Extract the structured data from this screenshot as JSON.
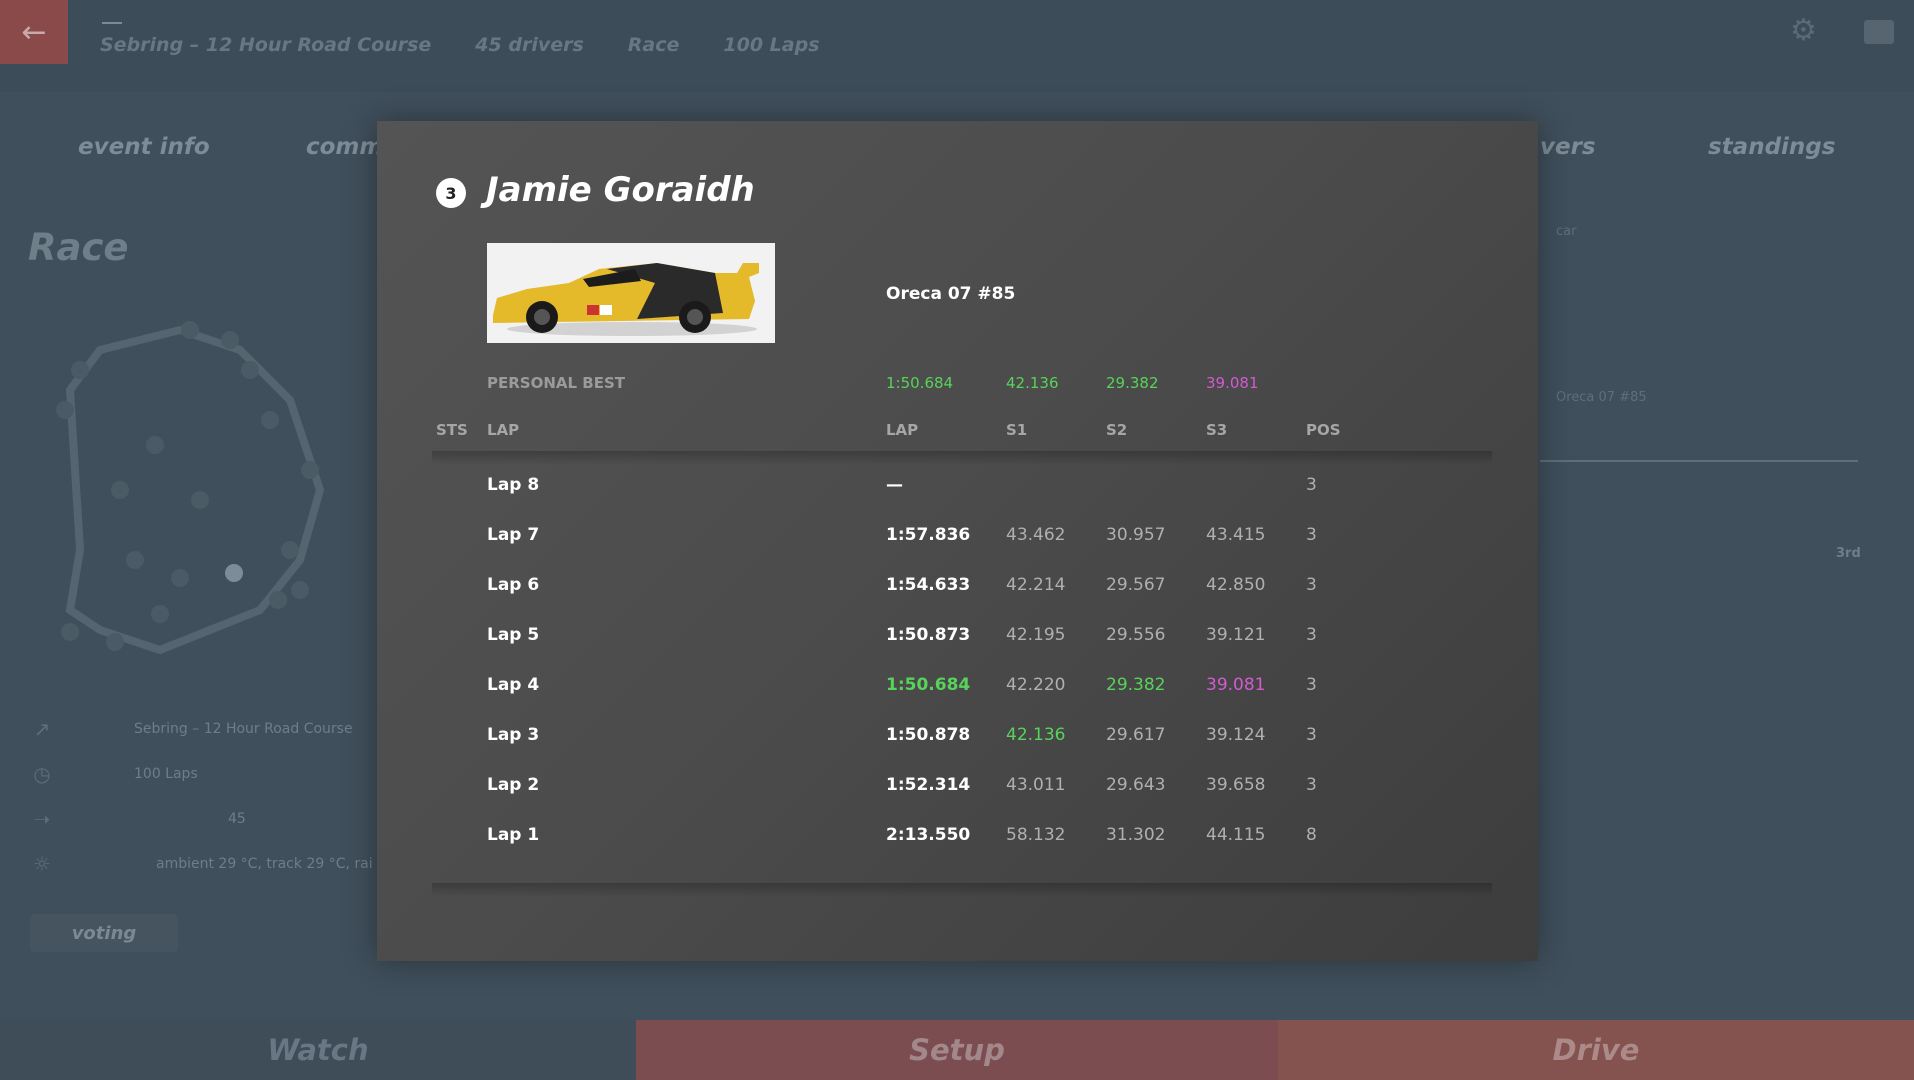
{
  "header": {
    "crumbs": [
      "Sebring – 12 Hour Road Course",
      "45 drivers",
      "Race",
      "100 Laps"
    ]
  },
  "tabs": {
    "event_info": "event info",
    "partial": "comm",
    "partial_right": "vers",
    "standings": "standings"
  },
  "race_title": "Race",
  "event_details": {
    "track": "Sebring – 12 Hour Road Course",
    "length": "100 Laps",
    "drivers": "45",
    "weather": "ambient 29 °C, track 29 °C, rai"
  },
  "voting_label": "voting",
  "right_panel": {
    "car_label": "car",
    "car_value": "Oreca 07 #85",
    "position_value": "3rd"
  },
  "bottom": {
    "watch": "Watch",
    "setup": "Setup",
    "drive": "Drive"
  },
  "modal": {
    "position": "3",
    "driver_name": "Jamie Goraidh",
    "car_name": "Oreca 07 #85",
    "personal_best": {
      "label": "PERSONAL BEST",
      "lap": "1:50.684",
      "s1": "42.136",
      "s2": "29.382",
      "s3": "39.081"
    },
    "columns": {
      "sts": "STS",
      "lap": "LAP",
      "laptime": "LAP",
      "s1": "S1",
      "s2": "S2",
      "s3": "S3",
      "pos": "POS"
    },
    "laps": [
      {
        "lap": "Lap 8",
        "time": "—",
        "s1": "",
        "s2": "",
        "s3": "",
        "pos": "3"
      },
      {
        "lap": "Lap 7",
        "time": "1:57.836",
        "s1": "43.462",
        "s2": "30.957",
        "s3": "43.415",
        "pos": "3"
      },
      {
        "lap": "Lap 6",
        "time": "1:54.633",
        "s1": "42.214",
        "s2": "29.567",
        "s3": "42.850",
        "pos": "3"
      },
      {
        "lap": "Lap 5",
        "time": "1:50.873",
        "s1": "42.195",
        "s2": "29.556",
        "s3": "39.121",
        "pos": "3"
      },
      {
        "lap": "Lap 4",
        "time": "1:50.684",
        "s1": "42.220",
        "s2": "29.382",
        "s3": "39.081",
        "pos": "3"
      },
      {
        "lap": "Lap 3",
        "time": "1:50.878",
        "s1": "42.136",
        "s2": "29.617",
        "s3": "39.124",
        "pos": "3"
      },
      {
        "lap": "Lap 2",
        "time": "1:52.314",
        "s1": "43.011",
        "s2": "29.643",
        "s3": "39.658",
        "pos": "3"
      },
      {
        "lap": "Lap 1",
        "time": "2:13.550",
        "s1": "58.132",
        "s2": "31.302",
        "s3": "44.115",
        "pos": "8"
      }
    ]
  },
  "colors": {
    "best_green": "#58d35a",
    "best_purple": "#d35ad3"
  }
}
